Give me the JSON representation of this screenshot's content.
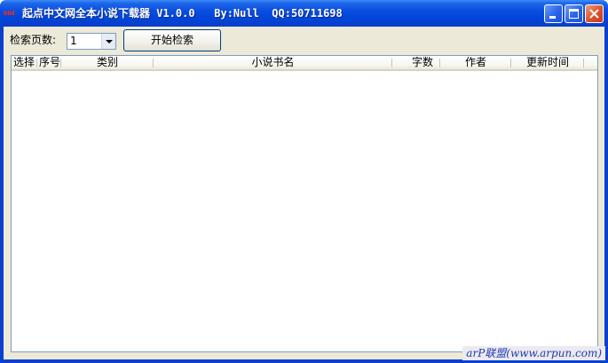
{
  "window": {
    "title": "起点中文网全本小说下载器 V1.0.0   By:Null  QQ:50711698",
    "icon": "book-icon",
    "icon_text": "bbd",
    "controls": {
      "minimize_icon": "minimize-icon",
      "maximize_icon": "maximize-icon",
      "close_icon": "close-icon"
    },
    "colors": {
      "titlebar": "#0a4fe0",
      "close": "#e0502a",
      "face": "#ece9d8"
    }
  },
  "toolbar": {
    "pages_label": "检索页数:",
    "pages_value": "1",
    "search_button": "开始检索"
  },
  "table": {
    "columns": [
      {
        "label": "选择"
      },
      {
        "label": "序号"
      },
      {
        "label": "类别"
      },
      {
        "label": "小说书名"
      },
      {
        "label": "字数"
      },
      {
        "label": "作者"
      },
      {
        "label": "更新时间"
      }
    ],
    "rows": []
  },
  "watermark": "arP联盟(www.arpun.com)"
}
